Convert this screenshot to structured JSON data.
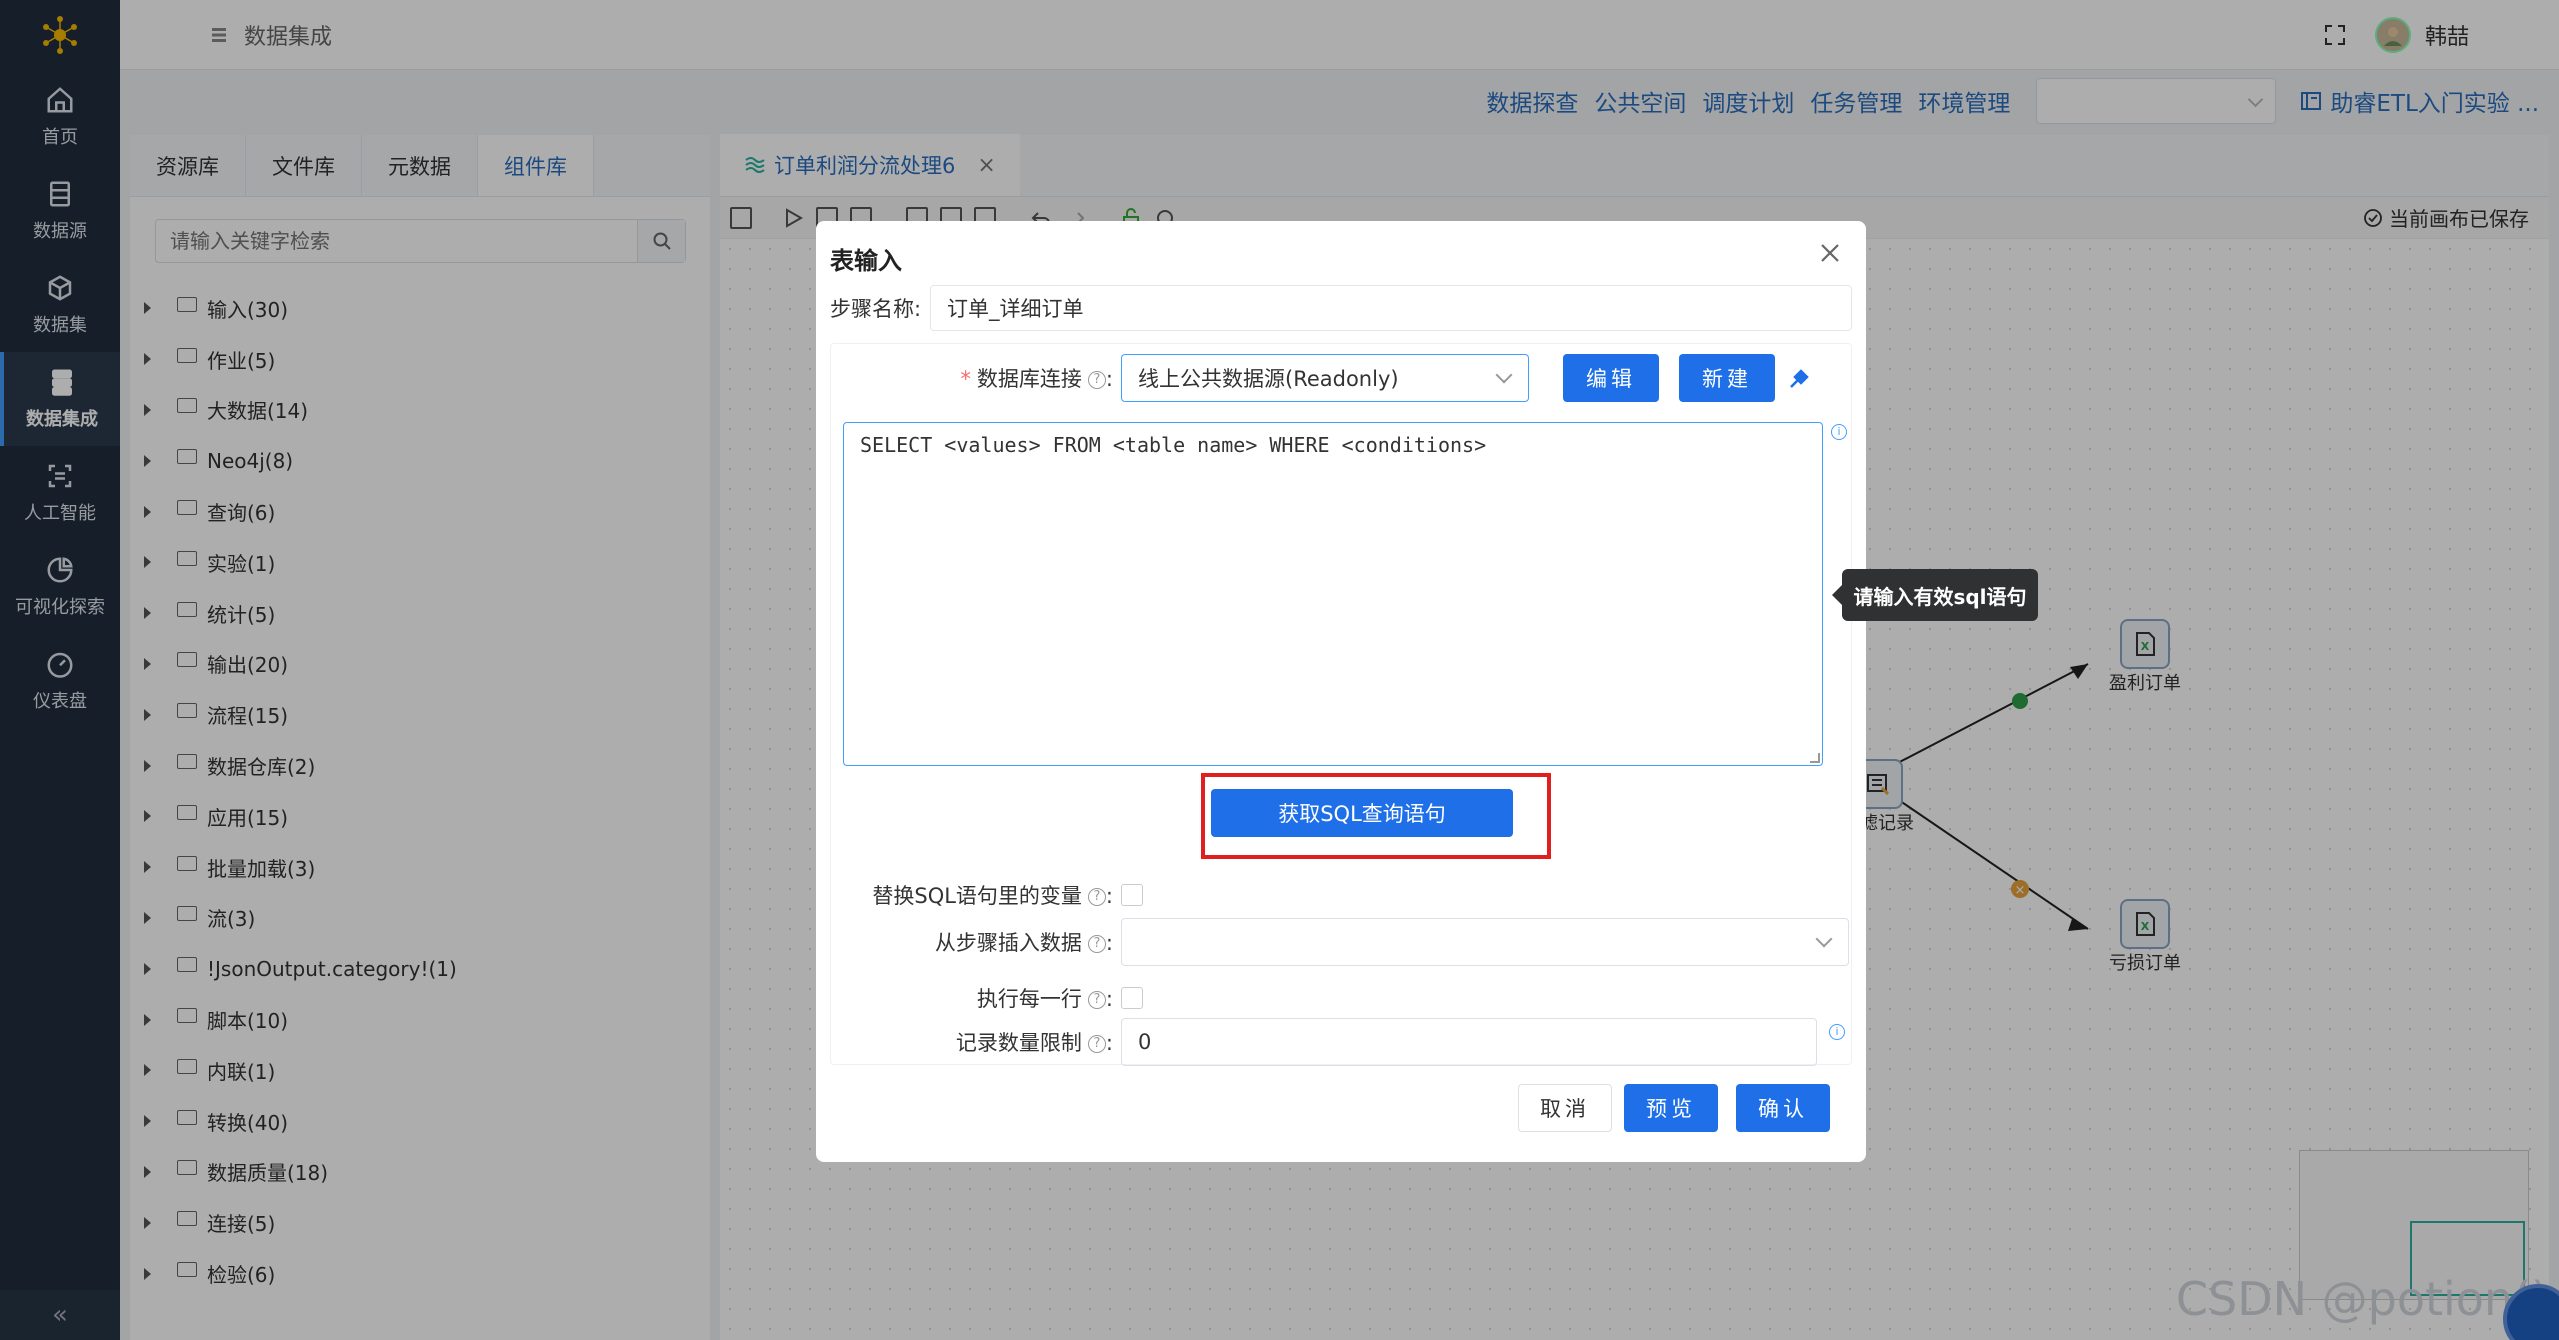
{
  "nav": {
    "items": [
      {
        "label": "首页",
        "icon": "home-icon"
      },
      {
        "label": "数据源",
        "icon": "database-icon"
      },
      {
        "label": "数据集",
        "icon": "cube-icon"
      },
      {
        "label": "数据集成",
        "icon": "server-stack-icon"
      },
      {
        "label": "人工智能",
        "icon": "ai-icon"
      },
      {
        "label": "可视化探索",
        "icon": "pie-chart-icon"
      },
      {
        "label": "仪表盘",
        "icon": "gauge-icon"
      }
    ],
    "active_index": 3,
    "collapse_label": "«"
  },
  "topbar": {
    "breadcrumb": "数据集成",
    "username": "韩喆"
  },
  "subheader": {
    "links": [
      "数据探查",
      "公共空间",
      "调度计划",
      "任务管理",
      "环境管理"
    ],
    "guide": "助睿ETL入门实验 ..."
  },
  "leftpanel": {
    "tabs": [
      "资源库",
      "文件库",
      "元数据",
      "组件库"
    ],
    "active_tab": 3,
    "search_placeholder": "请输入关键字检索",
    "tree": [
      "输入(30)",
      "作业(5)",
      "大数据(14)",
      "Neo4j(8)",
      "查询(6)",
      "实验(1)",
      "统计(5)",
      "输出(20)",
      "流程(15)",
      "数据仓库(2)",
      "应用(15)",
      "批量加载(3)",
      "流(3)",
      "!JsonOutput.category!(1)",
      "脚本(10)",
      "内联(1)",
      "转换(40)",
      "数据质量(18)",
      "连接(5)",
      "检验(6)"
    ]
  },
  "canvas": {
    "tab_label": "订单利润分流处理6",
    "tab_close": "×",
    "saved_label": "当前画布已保存",
    "nodes": [
      {
        "label": "过滤记录"
      },
      {
        "label": "盈利订单"
      },
      {
        "label": "亏损订单"
      }
    ]
  },
  "dialog": {
    "title": "表输入",
    "step_name_label": "步骤名称:",
    "step_name_value": "订单_详细订单",
    "db_conn_label": "数据库连接",
    "db_conn_value": "线上公共数据源(Readonly)",
    "edit_btn": "编辑",
    "new_btn": "新建",
    "sql_text": "SELECT <values> FROM <table name> WHERE <conditions>",
    "get_sql_btn": "获取SQL查询语句",
    "replace_vars_label": "替换SQL语句里的变量",
    "insert_from_step_label": "从步骤插入数据",
    "exec_each_row_label": "执行每一行",
    "record_limit_label": "记录数量限制",
    "record_limit_value": "0",
    "cancel_btn": "取消",
    "preview_btn": "预览",
    "confirm_btn": "确认"
  },
  "tooltip": {
    "text": "请输入有效sql语句"
  },
  "watermark": "CSDN @potion()"
}
